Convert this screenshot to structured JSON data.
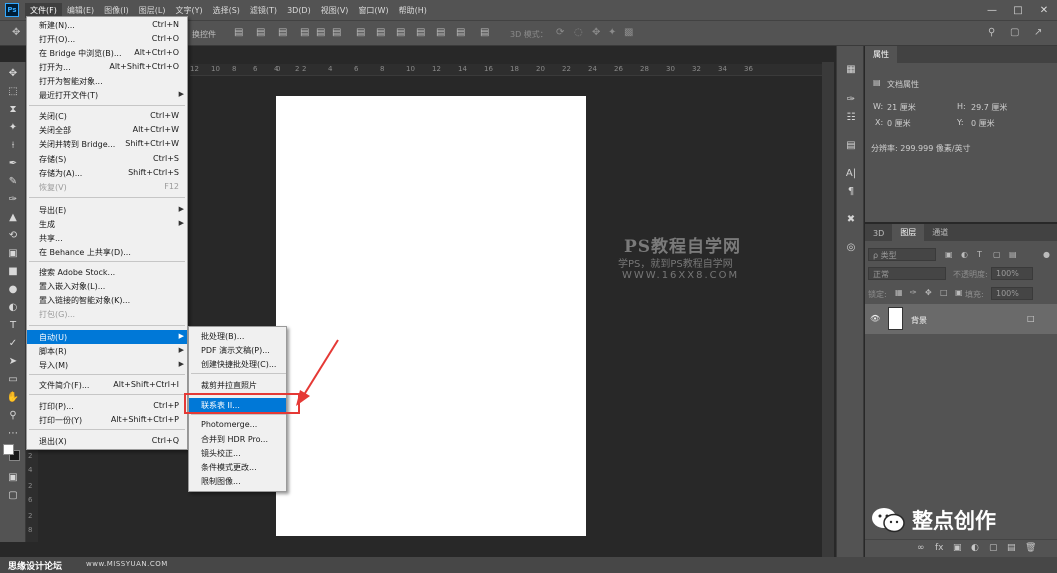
{
  "app": {
    "logo": "Ps"
  },
  "menubar": {
    "items": [
      "文件(F)",
      "编辑(E)",
      "图像(I)",
      "图层(L)",
      "文字(Y)",
      "选择(S)",
      "滤镜(T)",
      "3D(D)",
      "视图(V)",
      "窗口(W)",
      "帮助(H)"
    ],
    "active_index": 0,
    "window_controls": [
      "minimize-icon",
      "restore-icon",
      "close-icon"
    ]
  },
  "optionsbar": {
    "transform_label": "换控件",
    "mode_3d": "3D 模式："
  },
  "file_menu": {
    "items": [
      {
        "label": "新建(N)...",
        "shortcut": "Ctrl+N"
      },
      {
        "label": "打开(O)...",
        "shortcut": "Ctrl+O"
      },
      {
        "label": "在 Bridge 中浏览(B)...",
        "shortcut": "Alt+Ctrl+O"
      },
      {
        "label": "打开为...",
        "shortcut": "Alt+Shift+Ctrl+O"
      },
      {
        "label": "打开为智能对象...",
        "shortcut": ""
      },
      {
        "label": "最近打开文件(T)",
        "shortcut": "",
        "submenu": true
      },
      {
        "label": "关闭(C)",
        "shortcut": "Ctrl+W"
      },
      {
        "label": "关闭全部",
        "shortcut": "Alt+Ctrl+W"
      },
      {
        "label": "关闭并转到 Bridge...",
        "shortcut": "Shift+Ctrl+W"
      },
      {
        "label": "存储(S)",
        "shortcut": "Ctrl+S"
      },
      {
        "label": "存储为(A)...",
        "shortcut": "Shift+Ctrl+S"
      },
      {
        "label": "恢复(V)",
        "shortcut": "F12",
        "disabled": true
      },
      {
        "label": "导出(E)",
        "shortcut": "",
        "submenu": true
      },
      {
        "label": "生成",
        "shortcut": "",
        "submenu": true
      },
      {
        "label": "共享...",
        "shortcut": ""
      },
      {
        "label": "在 Behance 上共享(D)...",
        "shortcut": ""
      },
      {
        "label": "搜索 Adobe Stock...",
        "shortcut": ""
      },
      {
        "label": "置入嵌入对象(L)...",
        "shortcut": ""
      },
      {
        "label": "置入链接的智能对象(K)...",
        "shortcut": ""
      },
      {
        "label": "打包(G)...",
        "shortcut": "",
        "disabled": true
      },
      {
        "label": "自动(U)",
        "shortcut": "",
        "submenu": true,
        "active": true
      },
      {
        "label": "脚本(R)",
        "shortcut": "",
        "submenu": true
      },
      {
        "label": "导入(M)",
        "shortcut": "",
        "submenu": true
      },
      {
        "label": "文件简介(F)...",
        "shortcut": "Alt+Shift+Ctrl+I"
      },
      {
        "label": "打印(P)...",
        "shortcut": "Ctrl+P"
      },
      {
        "label": "打印一份(Y)",
        "shortcut": "Alt+Shift+Ctrl+P"
      },
      {
        "label": "退出(X)",
        "shortcut": "Ctrl+Q"
      }
    ]
  },
  "automate_menu": {
    "items": [
      {
        "label": "批处理(B)..."
      },
      {
        "label": "PDF 演示文稿(P)..."
      },
      {
        "label": "创建快捷批处理(C)..."
      },
      {
        "label": "裁剪并拉直照片"
      },
      {
        "label": "联系表 II...",
        "active": true
      },
      {
        "label": "Photomerge..."
      },
      {
        "label": "合并到 HDR Pro..."
      },
      {
        "label": "镜头校正..."
      },
      {
        "label": "条件模式更改..."
      },
      {
        "label": "限制图像..."
      }
    ]
  },
  "ruler": {
    "top_labels": [
      "12",
      "10",
      "8",
      "6",
      "4",
      "2",
      "0",
      "2",
      "4",
      "6",
      "8",
      "10",
      "12",
      "14",
      "16",
      "18",
      "20",
      "22",
      "24",
      "26",
      "28",
      "30",
      "32",
      "34",
      "36"
    ],
    "left_labels": [
      "2",
      "4",
      "2",
      "6",
      "2",
      "8"
    ]
  },
  "watermark": {
    "title": "PS教程自学网",
    "subtitle": "学PS，就到PS教程自学网",
    "url": "WWW.16XX8.COM"
  },
  "properties": {
    "tab": "属性",
    "heading": "文档属性",
    "w_label": "W:",
    "w_value": "21 厘米",
    "h_label": "H:",
    "h_value": "29.7 厘米",
    "x_label": "X:",
    "x_value": "0 厘米",
    "y_label": "Y:",
    "y_value": "0 厘米",
    "resolution": "分辨率: 299.999 像素/英寸"
  },
  "layers_panel": {
    "tabs": [
      "3D",
      "图层",
      "通道"
    ],
    "active_tab": 1,
    "filter_label": "ρ 类型",
    "blend_mode": "正常",
    "opacity_label": "不透明度:",
    "opacity_value": "100%",
    "lock_label": "锁定:",
    "fill_label": "填充:",
    "fill_value": "100%",
    "layer_name": "背景"
  },
  "status": {
    "left_text": "思缘设计论坛",
    "url_text": "www.MISSYUAN.COM"
  },
  "brand": {
    "text": "整点创作"
  }
}
